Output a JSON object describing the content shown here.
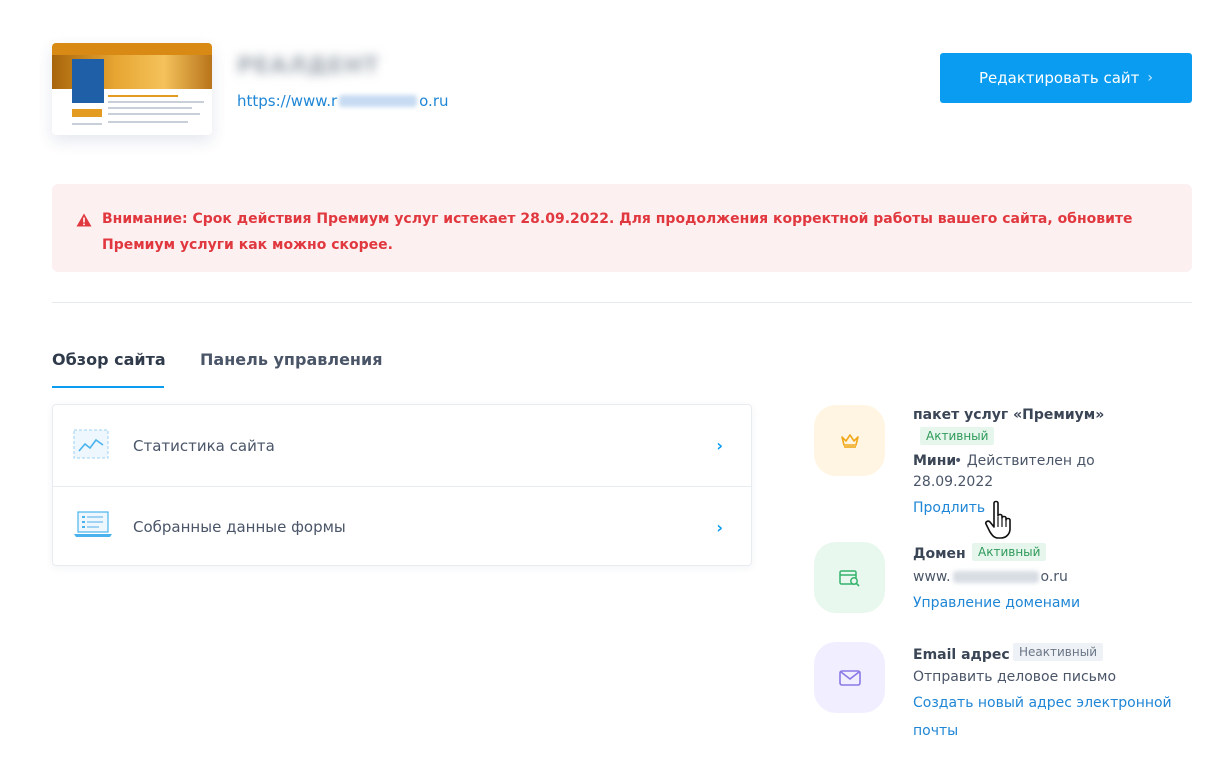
{
  "header": {
    "site_title": "РЕАЛДЕНТ",
    "url_prefix": "https://www.r",
    "url_suffix": "o.ru",
    "edit_button": "Редактировать сайт",
    "edit_chevron": "›"
  },
  "alert": {
    "text": "Внимание: Срок действия Премиум услуг истекает 28.09.2022. Для продолжения корректной работы вашего сайта, обновите Премиум услуги как можно скорее."
  },
  "tabs": [
    {
      "label": "Обзор сайта"
    },
    {
      "label": "Панель управления"
    }
  ],
  "cards": [
    {
      "label": "Статистика сайта",
      "icon": "stats-chart-icon"
    },
    {
      "label": "Собранные данные формы",
      "icon": "form-data-laptop-icon"
    }
  ],
  "services": {
    "premium": {
      "title": "пакет услуг «Премиум»",
      "status": "Активный",
      "plan": "Мини",
      "valid_text": "• Действителен до",
      "date": "28.09.2022",
      "link": "Продлить",
      "icon": "crown-icon"
    },
    "domain": {
      "title": "Домен",
      "status": "Активный",
      "url_prefix": "www.",
      "url_suffix": "o.ru",
      "link": "Управление доменами",
      "icon": "domain-search-icon"
    },
    "email": {
      "title": "Email адрес",
      "status": "Неактивный",
      "desc": "Отправить деловое письмо",
      "link_line1": "Создать новый адрес электронной",
      "link_line2": "почты",
      "icon": "envelope-icon"
    }
  },
  "colors": {
    "accent": "#0a9cf0",
    "alert_bg": "#fdf0f1",
    "alert_text": "#e0383e",
    "active_badge": "#2f9a5a"
  }
}
